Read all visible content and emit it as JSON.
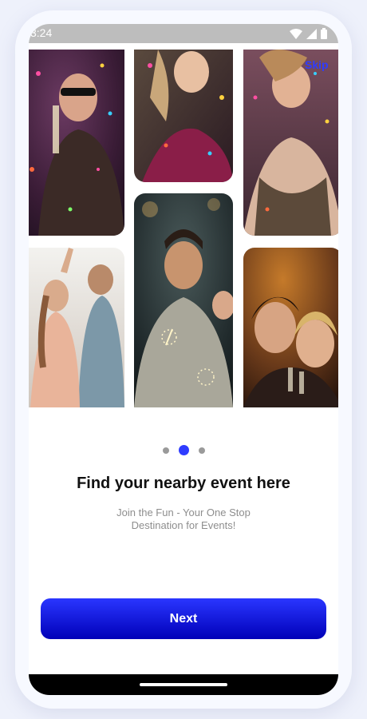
{
  "status": {
    "time": "3:24",
    "icons": [
      "wifi-icon",
      "signal-icon",
      "battery-icon"
    ]
  },
  "gallery": {
    "photos": [
      "party-photo-sunglasses-man",
      "party-photo-confetti-woman",
      "party-photo-celebrating-woman",
      "party-photo-rooftop-friends",
      "party-photo-sparkler-friends",
      "party-photo-toasting-women"
    ]
  },
  "onboarding": {
    "skip_label": "Skip",
    "pager": {
      "total": 3,
      "active_index": 1
    },
    "title": "Find your nearby event here",
    "subtitle": "Join the Fun - Your One Stop Destination for Events!",
    "next_label": "Next"
  },
  "colors": {
    "accent": "#2f3cff",
    "button_gradient_top": "#2a36ff",
    "button_gradient_bottom": "#0000b8",
    "status_bar": "#bdbdbd"
  }
}
